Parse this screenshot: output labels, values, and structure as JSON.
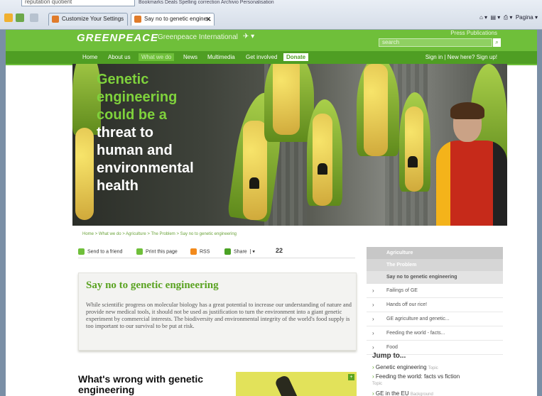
{
  "browser": {
    "address_text": "reputation quotient",
    "top_strip": "Bookmarks   Deals   Spelling correction   Archivio   Personalisation",
    "tabs": [
      {
        "label": "Customize Your Settings"
      },
      {
        "label": "Say no to genetic engine..."
      }
    ],
    "right_tools": "Pagina ▾"
  },
  "header": {
    "logo": "GREENPEACE",
    "site": "Greenpeace International",
    "toplinks": "Press  Publications",
    "search_placeholder": "search"
  },
  "nav": {
    "items": [
      "Home",
      "About us",
      "What we do",
      "News",
      "Multimedia",
      "Get involved",
      "Donate"
    ],
    "signin": "Sign in",
    "newhere": "New here? Sign up!"
  },
  "hero": {
    "line1": "Genetic",
    "line2": "engineering",
    "line3": "could be a",
    "line4": "threat to",
    "line5": "human and",
    "line6": "environmental",
    "line7": "health"
  },
  "content": {
    "breadcrumb": "Home > What we do > Agriculture > The Problem > Say no to genetic engineering",
    "share": {
      "send": "Send to a friend",
      "print": "Print this page",
      "rss": "RSS",
      "share": "Share",
      "count": "22"
    },
    "article_title": "Say no to genetic engineering",
    "article_body": "While scientific progress on molecular biology has a great potential to increase our understanding of nature and provide new medical tools, it should not be used as justification to turn the environment into a giant genetic experiment by commercial interests. The biodiversity and environmental integrity of the world's food supply is too important to our survival to be put at risk.",
    "wrong_title": "What's wrong with genetic engineering"
  },
  "sidebar": {
    "agriculture": "Agriculture",
    "problem": "The Problem",
    "sayno": "Say no to genetic engineering",
    "items": [
      "Failings of GE",
      "Hands off our rice!",
      "GE agriculture and genetic...",
      "Feeding the world - facts...",
      "Food"
    ],
    "jump": "Jump to...",
    "links": [
      {
        "text": "Genetic engineering",
        "type": "Topic"
      },
      {
        "text": "Feeding the world: facts vs fiction",
        "type": "Topic"
      },
      {
        "text": "GE in the EU",
        "type": "Background"
      }
    ]
  }
}
